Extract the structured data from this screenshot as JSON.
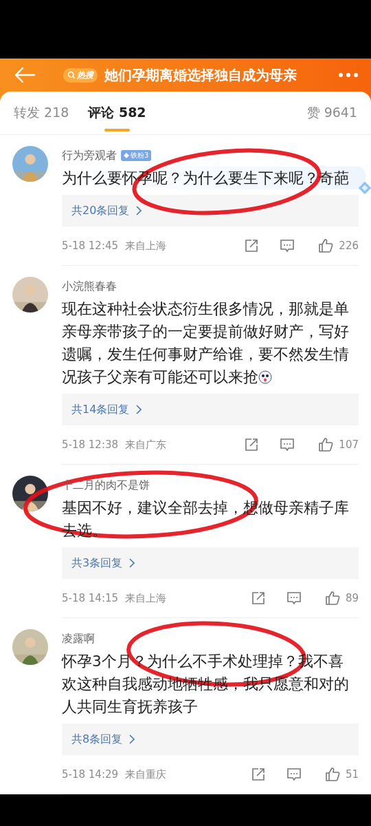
{
  "header": {
    "hot_tag": "热搜",
    "title": "她们孕期离婚选择独自成为母亲"
  },
  "tabs": [
    {
      "label": "转发 218",
      "selected": false
    },
    {
      "label": "评论 582",
      "selected": true
    },
    {
      "label": "赞 9641",
      "selected": false
    }
  ],
  "comments": [
    {
      "user": "行为旁观者",
      "badge": "铁粉3",
      "text": "为什么要怀孕呢？为什么要生下来呢？奇葩",
      "highlighted": true,
      "trailing_emoji": false,
      "circled": true,
      "replies": "共20条回复",
      "time": "5-18 12:45",
      "location": "来自上海",
      "likes": "226"
    },
    {
      "user": "小浣熊春春",
      "text": "现在这种社会状态衍生很多情况，那就是单亲母亲带孩子的一定要提前做好财产，写好遗嘱，发生任何事财产给谁，要不然发生情况孩子父亲有可能还可以来抢",
      "highlighted": false,
      "trailing_emoji": true,
      "circled": false,
      "replies": "共14条回复",
      "time": "5-18 12:38",
      "location": "来自广东",
      "likes": "107"
    },
    {
      "user": "十二月的肉不是饼",
      "text": "基因不好，建议全部去掉，想做母亲精子库去选。",
      "highlighted": false,
      "trailing_emoji": false,
      "circled": true,
      "replies": "共3条回复",
      "time": "5-18 14:15",
      "location": "来自上海",
      "likes": "89"
    },
    {
      "user": "凌露啊",
      "text": "怀孕3个月？为什么不手术处理掉？我不喜欢这种自我感动地牺牲感，我只愿意和对的人共同生育抚养孩子",
      "highlighted": false,
      "trailing_emoji": false,
      "circled": true,
      "replies": "共8条回复",
      "time": "5-18 14:29",
      "location": "来自重庆",
      "likes": "51"
    }
  ]
}
